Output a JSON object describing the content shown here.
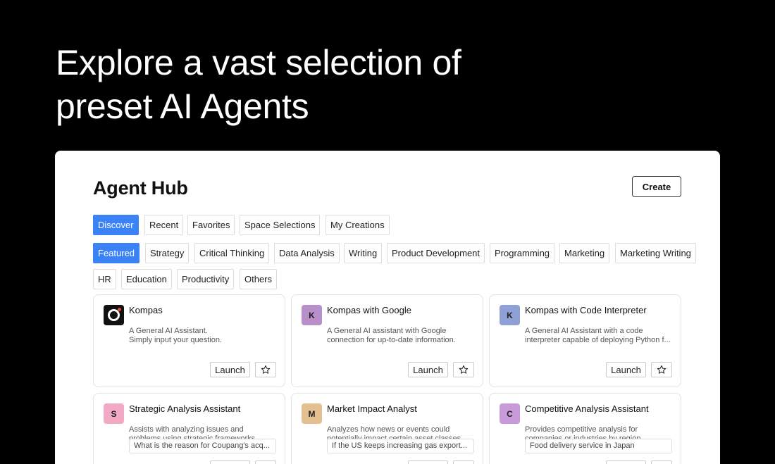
{
  "hero": {
    "line1": "Explore a vast selection of",
    "line2": "preset AI Agents"
  },
  "hub": {
    "title": "Agent Hub",
    "create_label": "Create"
  },
  "tabs": [
    "Discover",
    "Recent",
    "Favorites",
    "Space Selections",
    "My Creations"
  ],
  "categories": [
    "Featured",
    "Strategy",
    "Critical Thinking",
    "Data Analysis",
    "Writing",
    "Product Development",
    "Programming",
    "Marketing",
    "Marketing Writing",
    "HR",
    "Education",
    "Productivity",
    "Others"
  ],
  "accent_color": "#3b82f6",
  "agents": [
    {
      "icon": "kompas-logo-icon",
      "title": "Kompas",
      "desc1": "A General AI Assistant.",
      "desc2": "Simply input your question.",
      "launch": "Launch"
    },
    {
      "icon_letter": "K",
      "icon_color": "#b98fc9",
      "title": "Kompas with Google",
      "desc1": "A General AI assistant with Google",
      "desc2": "connection for up-to-date information.",
      "launch": "Launch"
    },
    {
      "icon_letter": "K",
      "icon_color": "#8fa0d6",
      "title": "Kompas with Code Interpreter",
      "desc1": "A General AI Assistant with a code",
      "desc2": "interpreter capable of deploying Python f...",
      "launch": "Launch"
    },
    {
      "icon_letter": "S",
      "icon_color": "#f2a9c4",
      "title": "Strategic Analysis Assistant",
      "desc1": "Assists with analyzing issues and",
      "desc2": "problems using strategic frameworks.",
      "prompt": "What is the reason for Coupang's acq..."
    },
    {
      "icon_letter": "M",
      "icon_color": "#e3c08f",
      "title": "Market Impact Analyst",
      "desc1": "Analyzes how news or events could",
      "desc2": "potentially impact certain asset classes...",
      "prompt": "If the US keeps increasing gas export..."
    },
    {
      "icon_letter": "C",
      "icon_color": "#c89ad9",
      "title": "Competitive Analysis Assistant",
      "desc1": "Provides competitive analysis for",
      "desc2": "companies or industries by region.",
      "prompt": "Food delivery service in Japan"
    }
  ]
}
